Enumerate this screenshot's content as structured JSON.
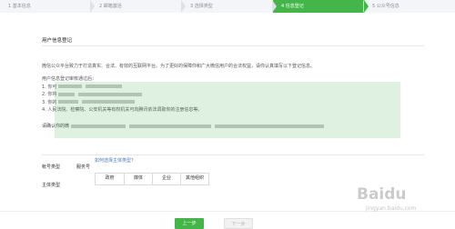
{
  "steps": [
    "1 基本信息",
    "2 邮箱激活",
    "3 选择类型",
    "4 信息登记",
    "5 公众号信息"
  ],
  "active_step": 3,
  "section_title": "用户信息登记",
  "intro": "微信公众平台致力于打造真实、合法、有效的互联网平台。为了更好的保障你和广大微信用户的合法权益，请你认真填写以下登记信息。",
  "list_header": "用户信息登记审核通过后：",
  "list_items": [
    "1. 你可",
    "2. 你将",
    "3. 你的",
    "4. 人民法院、检察院、公安机关等有权机关可向腾讯依法调取你的注册信息等。"
  ],
  "confirm_text": "请确认你的微",
  "account_type": {
    "label": "帐号类型",
    "value": "服务号"
  },
  "subject_type": {
    "label": "主体类型",
    "link": "如何选择主体类型？",
    "options": [
      "政府",
      "媒体",
      "企业",
      "其他组织"
    ]
  },
  "buttons": {
    "prev": "上一步",
    "next": "下一步"
  },
  "watermark": {
    "brand": "Baidu",
    "sub": "jingyan.baidu.com",
    "brand_color": "#bebebe",
    "band_color": "#50b45a"
  },
  "colors": {
    "primary": "#44b549",
    "link": "#4a7ab8"
  }
}
